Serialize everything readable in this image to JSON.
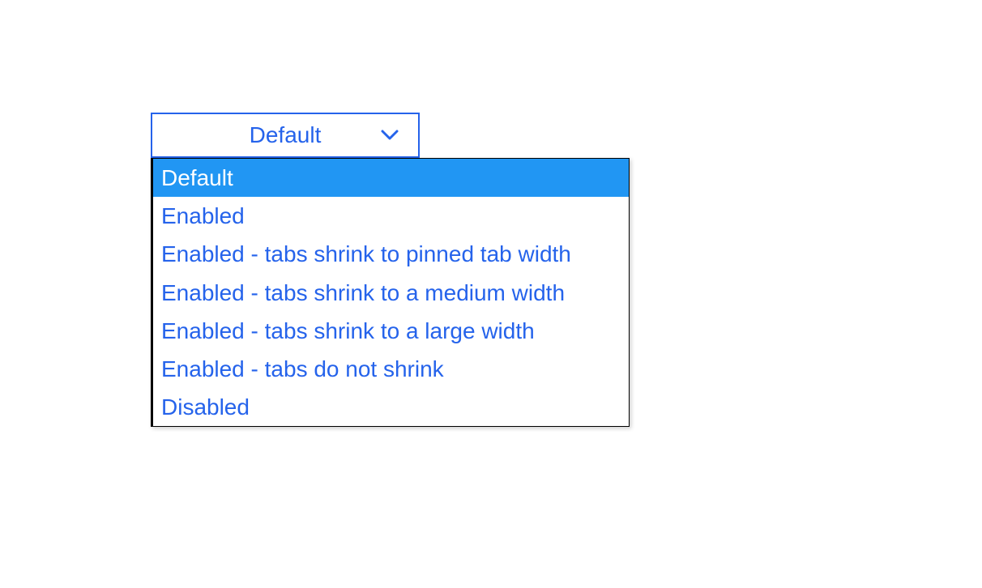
{
  "dropdown": {
    "selected_label": "Default",
    "selected_index": 0,
    "options": [
      "Default",
      "Enabled",
      "Enabled - tabs shrink to pinned tab width",
      "Enabled - tabs shrink to a medium width",
      "Enabled - tabs shrink to a large width",
      "Enabled - tabs do not shrink",
      "Disabled"
    ]
  },
  "colors": {
    "accent": "#2563eb",
    "highlight": "#2196f3"
  }
}
